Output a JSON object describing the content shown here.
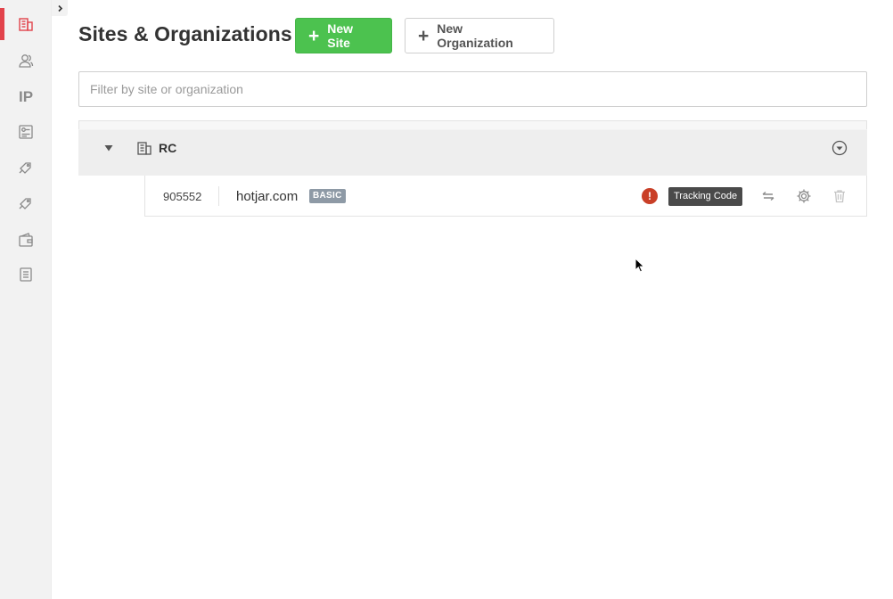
{
  "header": {
    "title": "Sites & Organizations",
    "new_site_label": "New Site",
    "new_org_label": "New Organization"
  },
  "filter": {
    "placeholder": "Filter by site or organization",
    "value": ""
  },
  "sidebar": {
    "items": [
      {
        "name": "organizations",
        "icon": "building-icon",
        "active": true
      },
      {
        "name": "users",
        "icon": "users-icon",
        "active": false
      },
      {
        "name": "ip",
        "label": "IP",
        "active": false
      },
      {
        "name": "settings",
        "icon": "sliders-icon",
        "active": false
      },
      {
        "name": "tag-1",
        "icon": "tag-icon",
        "active": false
      },
      {
        "name": "tag-2",
        "icon": "tag-icon",
        "active": false
      },
      {
        "name": "billing",
        "icon": "wallet-icon",
        "active": false
      },
      {
        "name": "invoices",
        "icon": "document-icon",
        "active": false
      }
    ]
  },
  "organization": {
    "name": "RC",
    "sites": [
      {
        "id": "905552",
        "name": "hotjar.com",
        "plan": "BASIC",
        "warning_symbol": "!",
        "tracking_label": "Tracking Code"
      }
    ]
  },
  "colors": {
    "accent_red": "#e2434b",
    "green": "#4cc24f",
    "warning": "#c93f27"
  }
}
